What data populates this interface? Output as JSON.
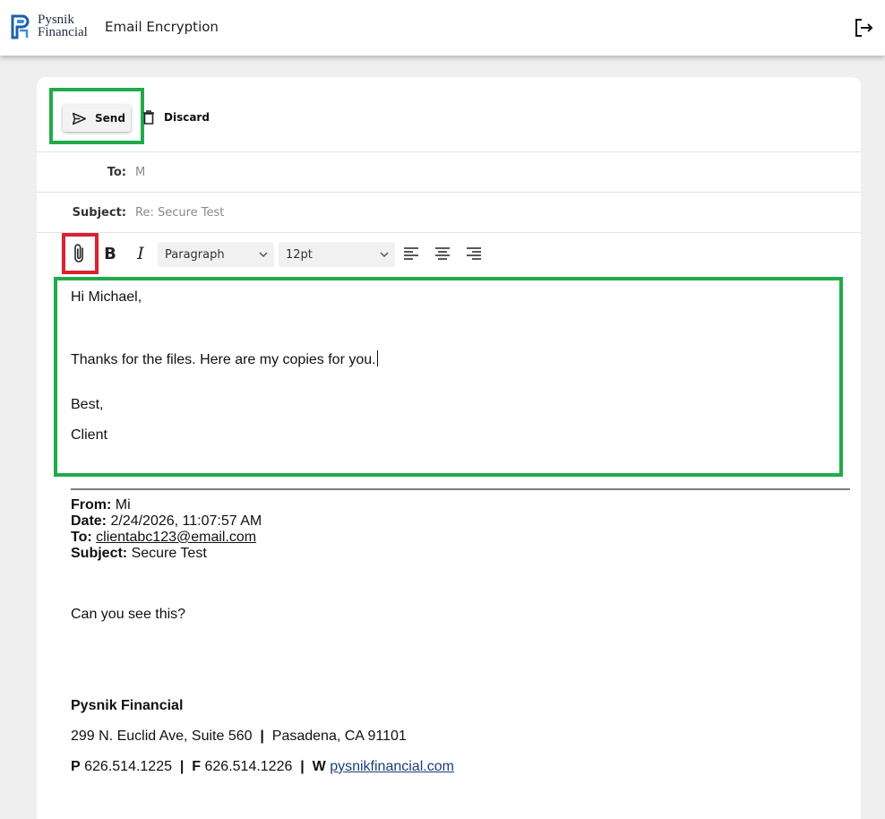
{
  "header": {
    "logo_line1": "Pysnik",
    "logo_line2": "Financial",
    "app_title": "Email Encryption",
    "logout_icon": "logout-icon"
  },
  "toolbar": {
    "send_label": "Send",
    "discard_label": "Discard"
  },
  "fields": {
    "to_label": "To:",
    "to_value": "M",
    "subject_label": "Subject:",
    "subject_value": "Re: Secure Test"
  },
  "format": {
    "bold": "B",
    "italic": "I",
    "block_format": "Paragraph",
    "font_size": "12pt"
  },
  "body": {
    "greeting": "Hi Michael,",
    "line1": "Thanks for the files. Here are my copies for you.",
    "signoff": "Best,",
    "name": "Client"
  },
  "quoted": {
    "from_label": "From:",
    "from_value": "Mi",
    "date_label": "Date:",
    "date_value": "2/24/2026, 11:07:57 AM",
    "to_label": "To:",
    "to_value": "clientabc123@email.com",
    "subject_label": "Subject:",
    "subject_value": "Secure Test",
    "message": "Can you see this?",
    "company": "Pysnik Financial",
    "address_street": "299 N. Euclid Ave, Suite 560",
    "sep": "|",
    "address_city": "Pasadena, CA 91101",
    "phone_label": "P",
    "phone": "626.514.1225",
    "fax_label": "F",
    "fax": "626.514.1226",
    "web_label": "W",
    "web": "pysnikfinancial.com"
  },
  "colors": {
    "highlight_green": "#22aa4a",
    "highlight_red": "#d9232f",
    "brand_blue": "#1f5fa8"
  }
}
